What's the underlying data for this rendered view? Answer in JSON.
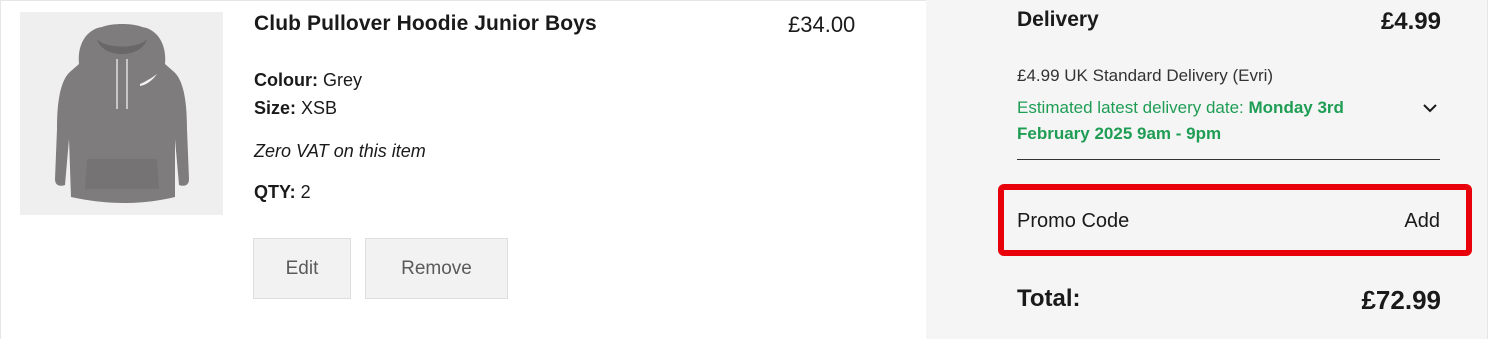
{
  "product": {
    "title": "Club Pullover Hoodie Junior Boys",
    "price": "£34.00",
    "colour_label": "Colour:",
    "colour_value": " Grey",
    "size_label": "Size:",
    "size_value": " XSB",
    "vat_note": "Zero VAT on this item",
    "qty_label": "QTY:",
    "qty_value": " 2",
    "image_icon": "hoodie-image",
    "image_color": "#7f7c7d"
  },
  "actions": {
    "edit_label": "Edit",
    "remove_label": "Remove"
  },
  "summary": {
    "delivery_label": "Delivery",
    "delivery_cost": "£4.99",
    "delivery_method": "£4.99 UK Standard Delivery (Evri)",
    "estimate_prefix": "Estimated latest delivery date: ",
    "estimate_date": "Monday 3rd February 2025 9am - 9pm",
    "estimate_color": "#1f9d55",
    "expand_icon": "chevron-down-icon",
    "promo_label": "Promo Code",
    "promo_action": "Add",
    "highlight_color": "#e8000b",
    "total_label": "Total:",
    "total_value": "£72.99"
  }
}
